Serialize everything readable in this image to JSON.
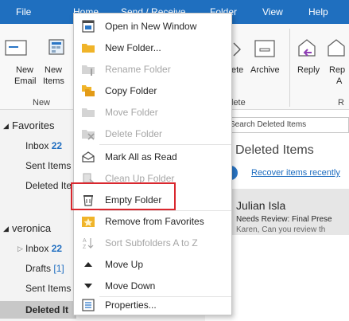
{
  "ribbon": {
    "tabs": [
      "File",
      "Home",
      "Send / Receive",
      "Folder",
      "View",
      "Help"
    ],
    "buttons": {
      "new_email_line1": "New",
      "new_email_line2": "Email",
      "new_items_line1": "New",
      "new_items_line2": "Items",
      "delete_partial": "ete",
      "archive": "Archive",
      "reply": "Reply",
      "reply_all_partial_1": "Rep",
      "reply_all_partial_2": "A"
    },
    "groups": {
      "new": "New",
      "delete_partial": "lete",
      "respond_partial": "R"
    }
  },
  "nav": {
    "favorites_header": "Favorites",
    "inbox_label": "Inbox",
    "inbox_count": "22",
    "sent_items": "Sent Items",
    "deleted_items_partial": "Deleted Ite",
    "account_header": "veronica",
    "account_inbox_label": "Inbox",
    "account_inbox_count": "22",
    "drafts_label": "Drafts",
    "drafts_count": "[1]",
    "account_sent_items": "Sent Items",
    "account_deleted_partial": "Deleted It"
  },
  "message_list": {
    "search_placeholder": "Search Deleted Items",
    "folder_title": "Deleted Items",
    "recover_link": "Recover items recently",
    "messages": [
      {
        "from": "Julian Isla",
        "subject": "Needs Review: Final Prese",
        "preview": "Karen,  Can you review th"
      }
    ]
  },
  "context_menu": {
    "items": [
      {
        "label": "Open in New Window",
        "enabled": true,
        "icon": "open-window-icon"
      },
      {
        "label": "New Folder...",
        "enabled": true,
        "icon": "new-folder-icon"
      },
      {
        "label": "Rename Folder",
        "enabled": false,
        "icon": "rename-folder-icon"
      },
      {
        "label": "Copy Folder",
        "enabled": true,
        "icon": "copy-folder-icon"
      },
      {
        "label": "Move Folder",
        "enabled": false,
        "icon": "move-folder-icon"
      },
      {
        "label": "Delete Folder",
        "enabled": false,
        "icon": "delete-folder-icon"
      },
      {
        "label": "Mark All as Read",
        "enabled": true,
        "icon": "mark-read-icon"
      },
      {
        "label": "Clean Up Folder",
        "enabled": false,
        "icon": "clean-up-icon"
      },
      {
        "label": "Empty Folder",
        "enabled": true,
        "icon": "empty-folder-icon",
        "highlighted": true
      },
      {
        "label": "Remove from Favorites",
        "enabled": true,
        "icon": "remove-favorite-icon"
      },
      {
        "label": "Sort Subfolders A to Z",
        "enabled": false,
        "icon": "sort-az-icon"
      },
      {
        "label": "Move Up",
        "enabled": true,
        "icon": "move-up-icon"
      },
      {
        "label": "Move Down",
        "enabled": true,
        "icon": "move-down-icon"
      },
      {
        "label": "Properties...",
        "enabled": true,
        "icon": "properties-icon"
      }
    ]
  },
  "colors": {
    "ribbon_blue": "#1f6fbf",
    "link_blue": "#1e6dc0",
    "highlight_red": "#d9272e",
    "disabled_text": "#a6a6a6"
  }
}
